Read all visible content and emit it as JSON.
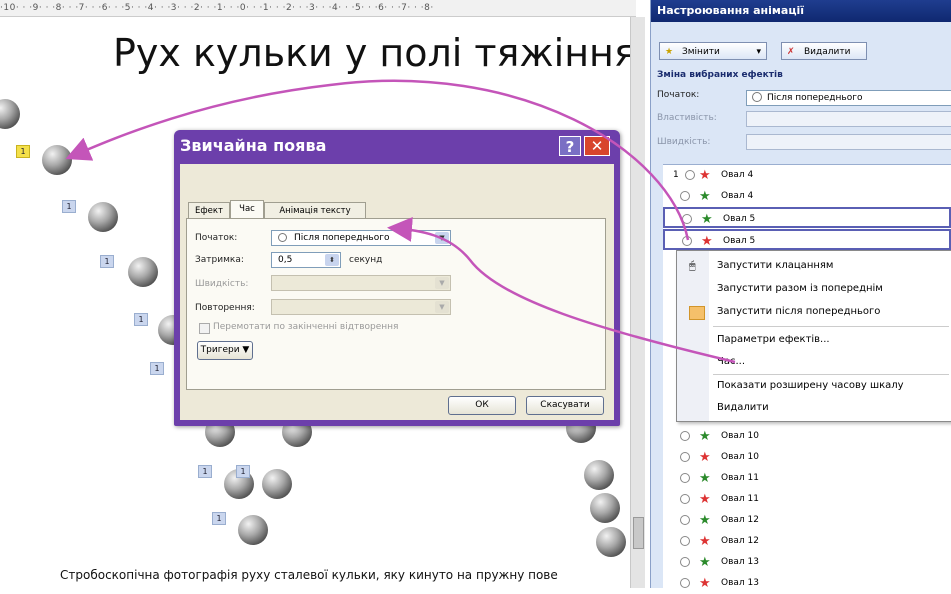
{
  "ruler": "·10· · ·9· · ·8· · ·7· · ·6· · ·5· · ·4· · ·3· · ·2· · ·1· · ·0· · ·1· · ·2· · ·3· · ·4· · ·5· · ·6· · ·7· · ·8·",
  "slide": {
    "title": "Рух кульки у полі тяжіння",
    "caption": "Стробоскопічна фотографія руху сталевої кульки, яку кинуто на пружну пове",
    "tag_label": "1"
  },
  "panel": {
    "header": "Настроювання анімації",
    "change_button": "Змінити",
    "delete_button": "Видалити",
    "section_title": "Зміна вибраних ефектів",
    "start_label": "Початок:",
    "start_value": "Після попереднього",
    "property_label": "Властивість:",
    "speed_label": "Швидкість:",
    "items": [
      {
        "num": "1",
        "star_color": "#d33",
        "label": "Овал 4"
      },
      {
        "num": "",
        "star_color": "#2b8a2b",
        "label": "Овал 4"
      },
      {
        "num": "",
        "star_color": "#2b8a2b",
        "label": "Овал 5"
      },
      {
        "num": "",
        "star_color": "#d33",
        "label": "Овал 5"
      },
      {
        "num": "",
        "star_color": "#2b8a2b",
        "label": "Овал 10"
      },
      {
        "num": "",
        "star_color": "#d33",
        "label": "Овал 10"
      },
      {
        "num": "",
        "star_color": "#2b8a2b",
        "label": "Овал 11"
      },
      {
        "num": "",
        "star_color": "#d33",
        "label": "Овал 11"
      },
      {
        "num": "",
        "star_color": "#2b8a2b",
        "label": "Овал 12"
      },
      {
        "num": "",
        "star_color": "#d33",
        "label": "Овал 12"
      },
      {
        "num": "",
        "star_color": "#2b8a2b",
        "label": "Овал 13"
      },
      {
        "num": "",
        "star_color": "#d33",
        "label": "Овал 13"
      }
    ]
  },
  "menu": {
    "items": [
      "Запустити клацанням",
      "Запустити разом із попереднім",
      "Запустити після попереднього",
      "Параметри ефектів...",
      "Час...",
      "Показати розширену часову шкалу",
      "Видалити"
    ]
  },
  "dialog": {
    "title": "Звичайна поява",
    "help": "?",
    "close": "✕",
    "tabs": [
      "Ефект",
      "Час",
      "Анімація тексту"
    ],
    "start_label": "Початок:",
    "start_value": "Після попереднього",
    "delay_label": "Затримка:",
    "delay_value": "0,5",
    "delay_unit": "секунд",
    "speed_label": "Швидкість:",
    "repeat_label": "Повторення:",
    "rewind_label": "Перемотати по закінченні відтворення",
    "triggers_button": "Тригери ▼",
    "ok_button": "ОК",
    "cancel_button": "Скасувати"
  },
  "colors": {
    "arrow": "#c455b9",
    "dialog_frame": "#6c3fab",
    "panel_bg": "#dbe6f6"
  }
}
